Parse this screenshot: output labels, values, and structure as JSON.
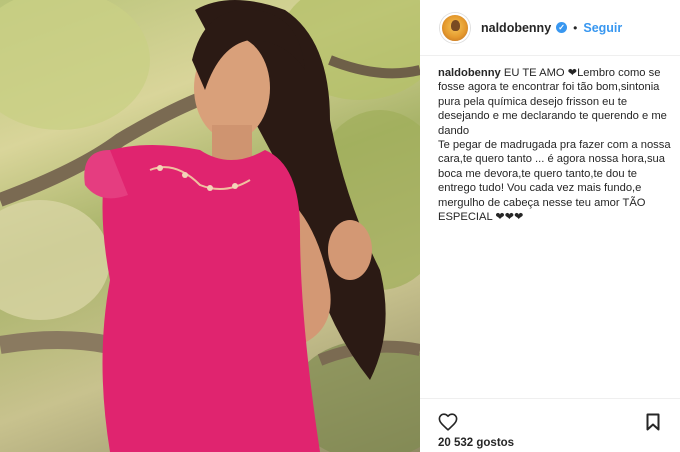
{
  "post": {
    "username": "naldobenny",
    "separator": "•",
    "follow_label": "Seguir",
    "caption_user": "naldobenny",
    "caption_text": " EU TE AMO ❤Lembro como se fosse agora te encontrar foi tão bom,sintonia pura pela química desejo frisson eu te desejando e me declarando te querendo e me dando\nTe pegar de madrugada pra fazer com a nossa cara,te quero tanto ... é agora nossa hora,sua boca me devora,te quero tanto,te dou te entrego tudo! Vou cada vez mais fundo,e mergulho de cabeça nesse teu amor TÃO ESPECIAL ❤❤❤",
    "likes": "20 532 gostos"
  },
  "icons": {
    "verified": "verified-badge-icon",
    "like": "heart-icon",
    "save": "bookmark-icon"
  },
  "colors": {
    "link_blue": "#3897f0",
    "dress_pink": "#e0246f",
    "text": "#262626"
  }
}
